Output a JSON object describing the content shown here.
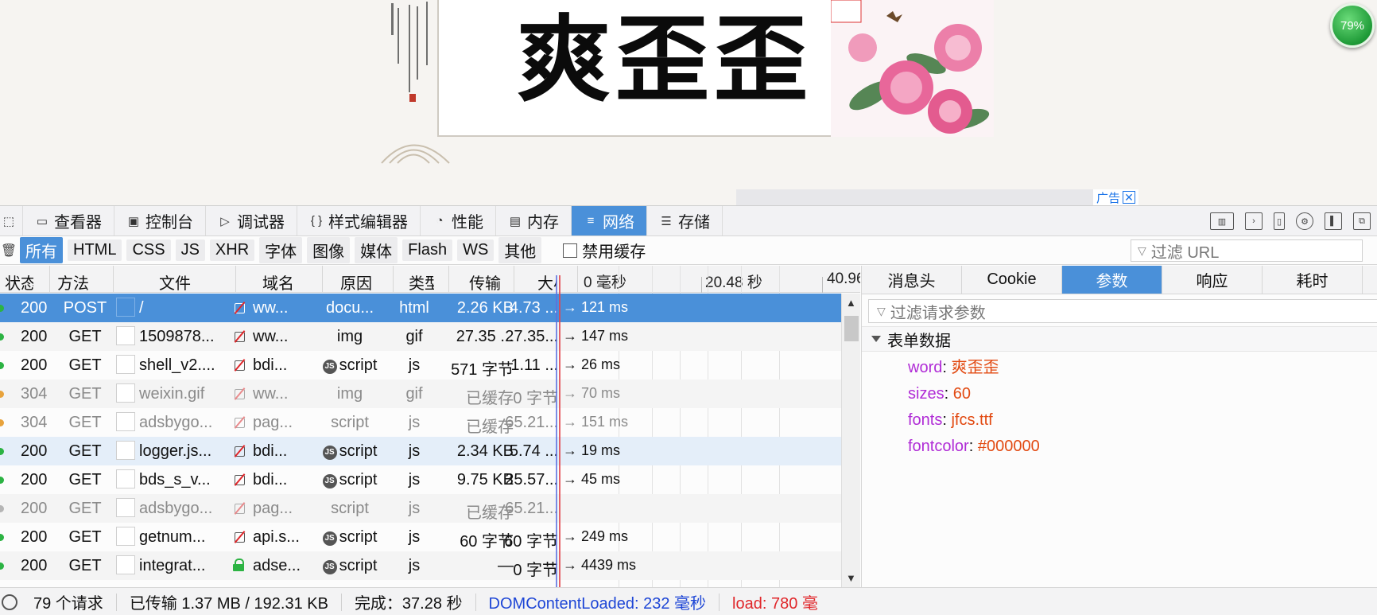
{
  "page": {
    "calligraphy_text": "爽歪歪",
    "ad_label": "广告",
    "zoom_badge": "79%"
  },
  "toolbox": {
    "tabs": [
      {
        "label": "查看器",
        "icon": "inspector-icon"
      },
      {
        "label": "控制台",
        "icon": "console-icon"
      },
      {
        "label": "调试器",
        "icon": "debugger-icon"
      },
      {
        "label": "样式编辑器",
        "icon": "style-editor-icon"
      },
      {
        "label": "性能",
        "icon": "performance-icon"
      },
      {
        "label": "内存",
        "icon": "memory-icon"
      },
      {
        "label": "网络",
        "icon": "network-icon",
        "active": true
      },
      {
        "label": "存储",
        "icon": "storage-icon"
      }
    ]
  },
  "filters": {
    "types": [
      "所有",
      "HTML",
      "CSS",
      "JS",
      "XHR",
      "字体",
      "图像",
      "媒体",
      "Flash",
      "WS",
      "其他"
    ],
    "active_type": "所有",
    "disable_cache_label": "禁用缓存",
    "url_placeholder": "过滤 URL"
  },
  "table": {
    "columns": [
      "状态",
      "方法",
      "文件",
      "域名",
      "原因",
      "类型",
      "传输",
      "大小"
    ],
    "waterfall_ticks": [
      "0 毫秒",
      "20.48 秒",
      "40.96"
    ],
    "rows": [
      {
        "status": "200",
        "method": "POST",
        "file": "/",
        "domain": "ww...",
        "cause": "docu...",
        "type": "html",
        "transferred": "2.26 KB",
        "size": "4.73 ...",
        "time": "→ 121 ms",
        "security": "insecure",
        "state": "selected",
        "js": false
      },
      {
        "status": "200",
        "method": "GET",
        "file": "1509878...",
        "domain": "ww...",
        "cause": "img",
        "type": "gif",
        "transferred": "27.35 ...",
        "size": "27.35...",
        "time": "→ 147 ms",
        "security": "insecure",
        "state": "normal",
        "js": false
      },
      {
        "status": "200",
        "method": "GET",
        "file": "shell_v2....",
        "domain": "bdi...",
        "cause": "script",
        "type": "js",
        "transferred": "571 字节",
        "size": "1.11 ...",
        "time": "→ 26 ms",
        "security": "insecure",
        "state": "normal",
        "js": true
      },
      {
        "status": "304",
        "method": "GET",
        "file": "weixin.gif",
        "domain": "ww...",
        "cause": "img",
        "type": "gif",
        "transferred": "已缓存",
        "size": "0 字节",
        "time": "→ 70 ms",
        "security": "insecure",
        "state": "cached",
        "js": false
      },
      {
        "status": "304",
        "method": "GET",
        "file": "adsbygo...",
        "domain": "pag...",
        "cause": "script",
        "type": "js",
        "transferred": "已缓存",
        "size": "65.21...",
        "time": "→ 151 ms",
        "security": "insecure",
        "state": "cached",
        "js": false
      },
      {
        "status": "200",
        "method": "GET",
        "file": "logger.js...",
        "domain": "bdi...",
        "cause": "script",
        "type": "js",
        "transferred": "2.34 KB",
        "size": "5.74 ...",
        "time": "→ 19 ms",
        "security": "insecure",
        "state": "hover",
        "js": true
      },
      {
        "status": "200",
        "method": "GET",
        "file": "bds_s_v...",
        "domain": "bdi...",
        "cause": "script",
        "type": "js",
        "transferred": "9.75 KB",
        "size": "25.57...",
        "time": "→ 45 ms",
        "security": "insecure",
        "state": "normal",
        "js": true
      },
      {
        "status": "200",
        "method": "GET",
        "file": "adsbygo...",
        "domain": "pag...",
        "cause": "script",
        "type": "js",
        "transferred": "已缓存",
        "size": "65.21...",
        "time": "",
        "security": "insecure",
        "state": "cached",
        "js": false
      },
      {
        "status": "200",
        "method": "GET",
        "file": "getnum...",
        "domain": "api.s...",
        "cause": "script",
        "type": "js",
        "transferred": "60 字节",
        "size": "60 字节",
        "time": "→ 249 ms",
        "security": "insecure",
        "state": "normal",
        "js": true
      },
      {
        "status": "200",
        "method": "GET",
        "file": "integrat...",
        "domain": "adse...",
        "cause": "script",
        "type": "js",
        "transferred": "—",
        "size": "0 字节",
        "time": "→ 4439 ms",
        "security": "secure",
        "state": "normal",
        "js": true
      }
    ]
  },
  "details": {
    "tabs": [
      "消息头",
      "Cookie",
      "参数",
      "响应",
      "耗时"
    ],
    "active_tab": "参数",
    "filter_placeholder": "过滤请求参数",
    "section_title": "表单数据",
    "params": [
      {
        "key": "word",
        "value": "爽歪歪"
      },
      {
        "key": "sizes",
        "value": "60"
      },
      {
        "key": "fonts",
        "value": "jfcs.ttf"
      },
      {
        "key": "fontcolor",
        "value": "#000000"
      }
    ]
  },
  "status_bar": {
    "requests": "79 个请求",
    "transferred": "已传输 1.37 MB / 192.31 KB",
    "finish": "完成：37.28 秒",
    "dom_content_loaded": "DOMContentLoaded: 232 毫秒",
    "load": "load: 780 毫"
  },
  "colors": {
    "accent": "#4a90d9",
    "param_key": "#b02cd6",
    "param_value": "#e24a12",
    "dcl": "#1e46d6",
    "load": "#e0262a"
  }
}
